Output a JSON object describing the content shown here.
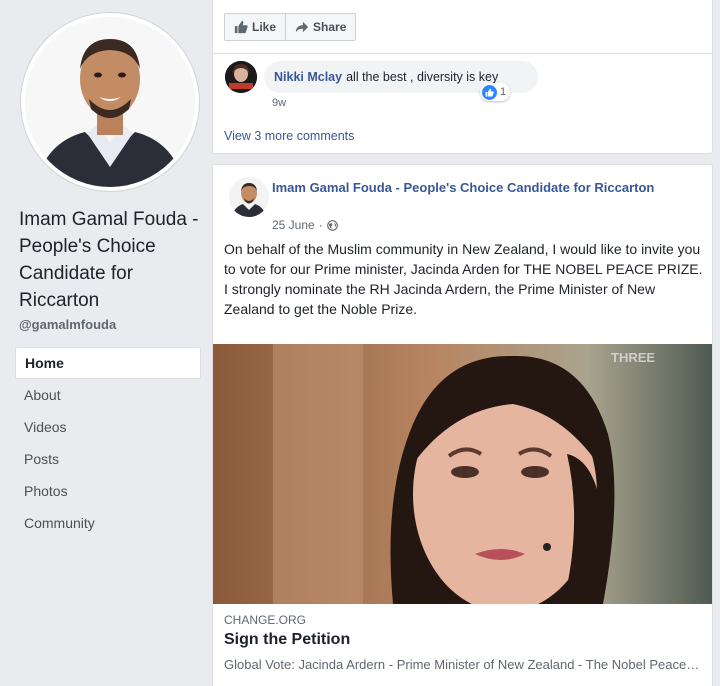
{
  "profile": {
    "name": "Imam Gamal Fouda - People's Choice Candidate for Riccarton",
    "handle": "@gamalmfouda"
  },
  "nav": {
    "items": [
      "Home",
      "About",
      "Videos",
      "Posts",
      "Photos",
      "Community"
    ],
    "active": "Home"
  },
  "actions": {
    "like_label": "Like",
    "share_label": "Share"
  },
  "comment": {
    "author": "Nikki Mclay",
    "text": "all the best , diversity is key",
    "time": "9w",
    "reaction_count": "1"
  },
  "view_more_comments": "View 3 more comments",
  "post": {
    "author": "Imam Gamal Fouda - People's Choice Candidate for Riccarton",
    "date": "25 June",
    "date_separator": "·",
    "text": "On behalf of the Muslim community in New Zealand, I would like to invite you to vote for our Prime minister, Jacinda Arden for THE NOBEL PEACE PRIZE.\nI strongly nominate the RH Jacinda Ardern, the Prime Minister of New Zealand to get the Noble Prize.",
    "image_watermark": "THREE",
    "link": {
      "source": "CHANGE.ORG",
      "title": "Sign the Petition",
      "description": "Global Vote: Jacinda Ardern - Prime Minister of New Zealand - The Nobel Peace Prize"
    }
  },
  "colors": {
    "background": "#e9ebee",
    "link_blue": "#385898",
    "like_blue": "#2d88ff"
  }
}
